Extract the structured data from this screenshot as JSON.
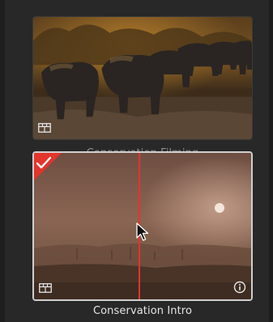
{
  "clips": [
    {
      "name": "Conservation Filming",
      "selected": false,
      "thumbnail": "elephant-herd-dusk"
    },
    {
      "name": "Conservation Intro",
      "selected": true,
      "thumbnail": "misty-savanna-sunrise",
      "playhead_position": 0.48
    }
  ],
  "icons": {
    "clip_type": "filmstrip-icon",
    "info": "info-icon",
    "selected": "checkmark-icon",
    "pointer": "mouse-cursor-icon"
  },
  "colors": {
    "background": "#282828",
    "selection_red": "#e2352d",
    "playhead": "#e2352d",
    "label_dim": "#8c8c8c",
    "label_active": "#e6e6e6"
  }
}
